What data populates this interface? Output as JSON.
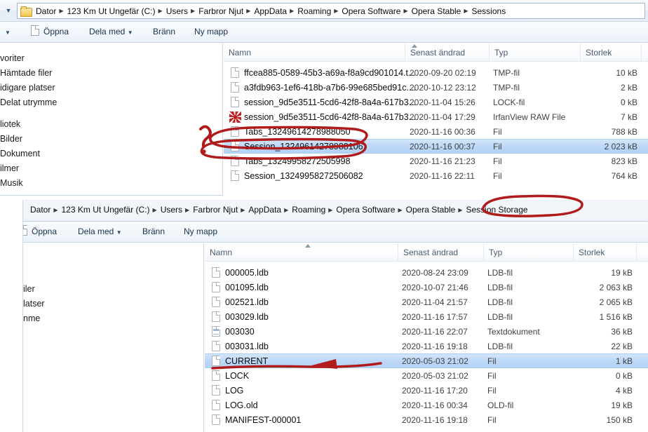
{
  "windows": [
    {
      "id": "window-sessions",
      "breadcrumb": [
        "Dator",
        "123 Km Ut Ungefär (C:)",
        "Users",
        "Farbror Njut",
        "AppData",
        "Roaming",
        "Opera Software",
        "Opera Stable",
        "Sessions"
      ],
      "toolbar": {
        "open_label": "Öppna",
        "share_label": "Dela med",
        "burn_label": "Bränn",
        "newfolder_label": "Ny mapp",
        "caret": "▼"
      },
      "nav_items": [
        "voriter",
        "Hämtade filer",
        "idigare platser",
        "Delat utrymme",
        "liotek",
        "Bilder",
        "Dokument",
        "ilmer",
        "Musik"
      ],
      "columns": [
        "Namn",
        "Senast ändrad",
        "Typ",
        "Storlek"
      ],
      "sort_column": "Senast ändrad",
      "files": [
        {
          "name": "ffcea885-0589-45b3-a69a-f8a9cd901014.t...",
          "modified": "2020-09-20 02:19",
          "type": "TMP-fil",
          "size": "10 kB",
          "icon": "file-icon",
          "selected": false
        },
        {
          "name": "a3fdb963-1ef6-418b-a7b6-99e685bed91c....",
          "modified": "2020-10-12 23:12",
          "type": "TMP-fil",
          "size": "2 kB",
          "icon": "file-icon",
          "selected": false
        },
        {
          "name": "session_9d5e3511-5cd6-42f8-8a4a-617b3...",
          "modified": "2020-11-04 15:26",
          "type": "LOCK-fil",
          "size": "0 kB",
          "icon": "file-icon",
          "selected": false
        },
        {
          "name": "session_9d5e3511-5cd6-42f8-8a4a-617b3...",
          "modified": "2020-11-04 17:29",
          "type": "IrfanView RAW File",
          "size": "7 kB",
          "icon": "irfanview-raw-icon",
          "selected": false
        },
        {
          "name": "Tabs_13249614278988050",
          "modified": "2020-11-16 00:36",
          "type": "Fil",
          "size": "788 kB",
          "icon": "file-icon",
          "selected": false
        },
        {
          "name": "Session_13249614278988106",
          "modified": "2020-11-16 00:37",
          "type": "Fil",
          "size": "2 023 kB",
          "icon": "file-icon",
          "selected": true
        },
        {
          "name": "Tabs_13249958272505998",
          "modified": "2020-11-16 21:23",
          "type": "Fil",
          "size": "823 kB",
          "icon": "file-icon",
          "selected": false
        },
        {
          "name": "Session_13249958272506082",
          "modified": "2020-11-16 22:11",
          "type": "Fil",
          "size": "764 kB",
          "icon": "file-icon",
          "selected": false
        }
      ]
    },
    {
      "id": "window-session-storage",
      "breadcrumb": [
        "Dator",
        "123 Km Ut Ungefär (C:)",
        "Users",
        "Farbror Njut",
        "AppData",
        "Roaming",
        "Opera Software",
        "Opera Stable",
        "Session Storage"
      ],
      "toolbar": {
        "open_label": "Öppna",
        "share_label": "Dela med",
        "burn_label": "Bränn",
        "newfolder_label": "Ny mapp",
        "caret": "▼"
      },
      "nav_items": [
        "iler",
        "latser",
        "nme"
      ],
      "columns": [
        "Namn",
        "Senast ändrad",
        "Typ",
        "Storlek"
      ],
      "sort_column": "Namn",
      "files": [
        {
          "name": "000005.ldb",
          "modified": "2020-08-24 23:09",
          "type": "LDB-fil",
          "size": "19 kB",
          "icon": "file-icon",
          "selected": false
        },
        {
          "name": "001095.ldb",
          "modified": "2020-10-07 21:46",
          "type": "LDB-fil",
          "size": "2 063 kB",
          "icon": "file-icon",
          "selected": false
        },
        {
          "name": "002521.ldb",
          "modified": "2020-11-04 21:57",
          "type": "LDB-fil",
          "size": "2 065 kB",
          "icon": "file-icon",
          "selected": false
        },
        {
          "name": "003029.ldb",
          "modified": "2020-11-16 17:57",
          "type": "LDB-fil",
          "size": "1 516 kB",
          "icon": "file-icon",
          "selected": false
        },
        {
          "name": "003030",
          "modified": "2020-11-16 22:07",
          "type": "Textdokument",
          "size": "36 kB",
          "icon": "text-document-icon",
          "selected": false
        },
        {
          "name": "003031.ldb",
          "modified": "2020-11-16 19:18",
          "type": "LDB-fil",
          "size": "22 kB",
          "icon": "file-icon",
          "selected": false
        },
        {
          "name": "CURRENT",
          "modified": "2020-05-03 21:02",
          "type": "Fil",
          "size": "1 kB",
          "icon": "file-icon",
          "selected": true
        },
        {
          "name": "LOCK",
          "modified": "2020-05-03 21:02",
          "type": "Fil",
          "size": "0 kB",
          "icon": "file-icon",
          "selected": false
        },
        {
          "name": "LOG",
          "modified": "2020-11-16 17:20",
          "type": "Fil",
          "size": "4 kB",
          "icon": "file-icon",
          "selected": false
        },
        {
          "name": "LOG.old",
          "modified": "2020-11-16 00:34",
          "type": "OLD-fil",
          "size": "19 kB",
          "icon": "file-icon",
          "selected": false
        },
        {
          "name": "MANIFEST-000001",
          "modified": "2020-11-16 19:18",
          "type": "Fil",
          "size": "150 kB",
          "icon": "file-icon",
          "selected": false
        }
      ]
    }
  ],
  "annotations": {
    "color": "#b01c1c",
    "marks": [
      {
        "name": "question-mark-annotation",
        "shape": "question-mark"
      },
      {
        "name": "ellipse-around-tabs-file",
        "shape": "ellipse"
      },
      {
        "name": "ellipse-around-session-file",
        "shape": "ellipse"
      },
      {
        "name": "ellipse-around-session-storage-crumb",
        "shape": "ellipse"
      },
      {
        "name": "arrow-pointing-to-current-file",
        "shape": "arrow"
      }
    ]
  }
}
